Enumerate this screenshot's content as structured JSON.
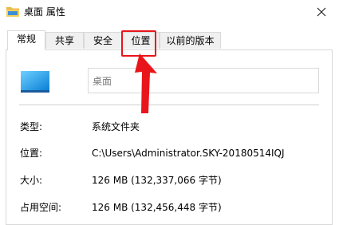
{
  "window": {
    "title": "桌面 属性",
    "title_icon": "folder-icon",
    "close_icon": "close-icon"
  },
  "tabs": [
    {
      "label": "常规",
      "active": true
    },
    {
      "label": "共享",
      "active": false
    },
    {
      "label": "安全",
      "active": false
    },
    {
      "label": "位置",
      "active": false
    },
    {
      "label": "以前的版本",
      "active": false
    }
  ],
  "general": {
    "icon": "desktop-icon",
    "name_value": "桌面",
    "rows": [
      {
        "label": "类型:",
        "value": "系统文件夹"
      },
      {
        "label": "位置:",
        "value": "C:\\Users\\Administrator.SKY-20180514IQJ"
      },
      {
        "label": "大小:",
        "value": "126 MB (132,337,066 字节)"
      },
      {
        "label": "占用空间:",
        "value": "126 MB (132,456,448 字节)"
      }
    ]
  },
  "annotation": {
    "highlight_color": "#e8161b",
    "highlight_target": "位置"
  }
}
